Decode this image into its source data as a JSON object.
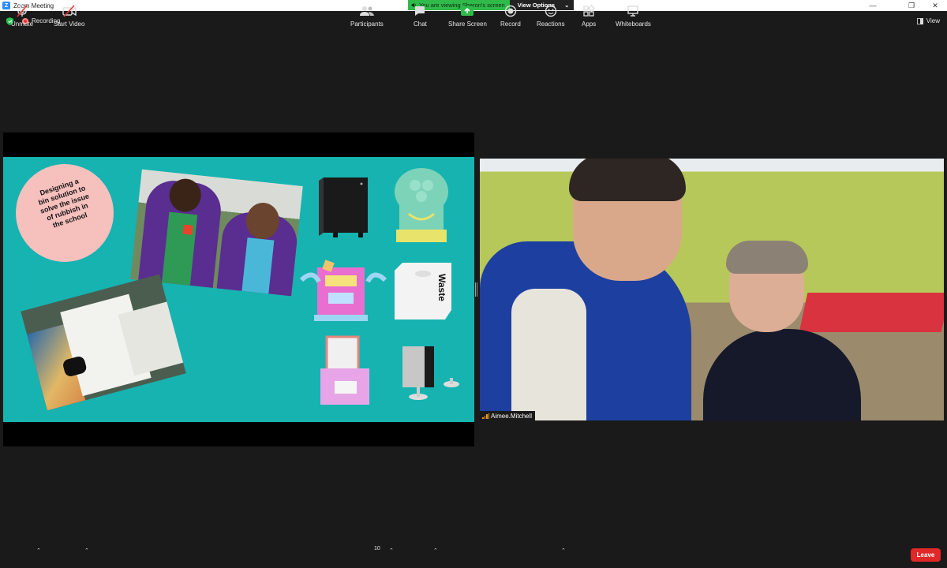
{
  "window": {
    "title": "Zoom Meeting"
  },
  "share_banner": {
    "viewing_text": "You are viewing Sharon's screen",
    "view_options_label": "View Options"
  },
  "status": {
    "recording_label": "Recording",
    "view_label": "View"
  },
  "slide": {
    "caption_lines": [
      "Designing a",
      "bin solution to",
      "solve the issue",
      "of rubbish in",
      "the school"
    ],
    "bin_label": "Waste"
  },
  "video": {
    "participant_name": "Aimee.Mitchell"
  },
  "toolbar": {
    "unmute_label": "Unmute",
    "start_video_label": "Start Video",
    "participants_label": "Participants",
    "participants_count": "10",
    "chat_label": "Chat",
    "share_screen_label": "Share Screen",
    "record_label": "Record",
    "reactions_label": "Reactions",
    "apps_label": "Apps",
    "whiteboards_label": "Whiteboards",
    "leave_label": "Leave"
  },
  "colors": {
    "share_green": "#2fba4a",
    "slide_teal": "#16b3b1",
    "leave_red": "#e02828",
    "zoom_blue": "#2D8CFF"
  }
}
